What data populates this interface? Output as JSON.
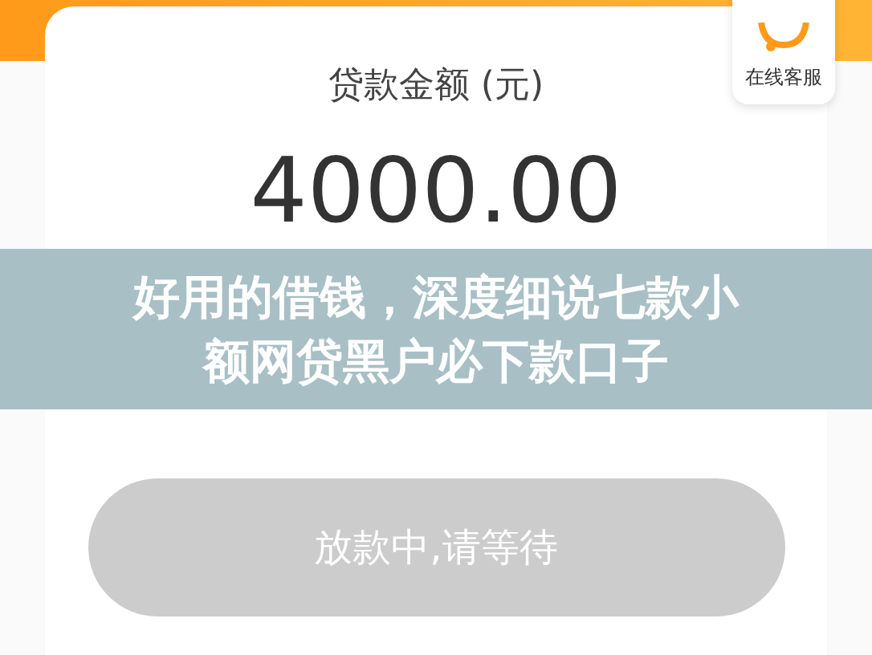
{
  "loan_card": {
    "label": "贷款金额 (元)",
    "amount": "4000.00"
  },
  "service": {
    "label": "在线客服"
  },
  "banner": {
    "lines": [
      "好用的借钱，深度细说七款小",
      "额网贷黑户必下款口子"
    ]
  },
  "submit_button": {
    "label": "放款中,请等待",
    "disabled": true
  }
}
